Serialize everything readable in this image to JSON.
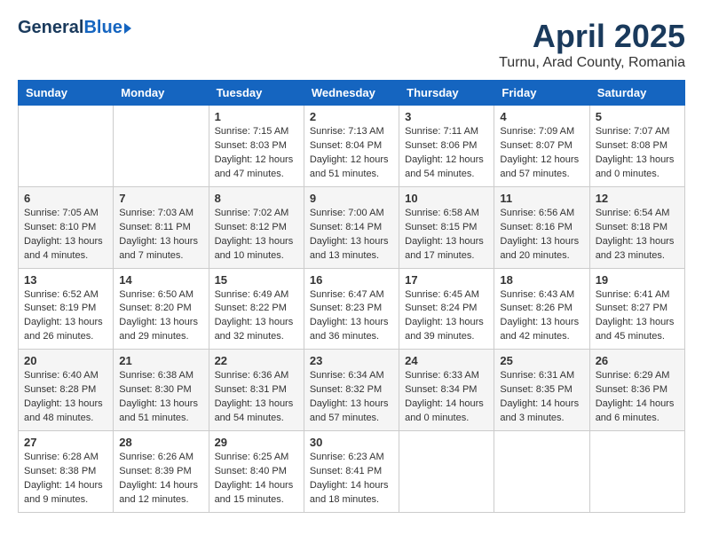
{
  "header": {
    "logo_general": "General",
    "logo_blue": "Blue",
    "month_year": "April 2025",
    "subtitle": "Turnu, Arad County, Romania"
  },
  "weekdays": [
    "Sunday",
    "Monday",
    "Tuesday",
    "Wednesday",
    "Thursday",
    "Friday",
    "Saturday"
  ],
  "weeks": [
    [
      {
        "day": "",
        "info": ""
      },
      {
        "day": "",
        "info": ""
      },
      {
        "day": "1",
        "info": "Sunrise: 7:15 AM\nSunset: 8:03 PM\nDaylight: 12 hours and 47 minutes."
      },
      {
        "day": "2",
        "info": "Sunrise: 7:13 AM\nSunset: 8:04 PM\nDaylight: 12 hours and 51 minutes."
      },
      {
        "day": "3",
        "info": "Sunrise: 7:11 AM\nSunset: 8:06 PM\nDaylight: 12 hours and 54 minutes."
      },
      {
        "day": "4",
        "info": "Sunrise: 7:09 AM\nSunset: 8:07 PM\nDaylight: 12 hours and 57 minutes."
      },
      {
        "day": "5",
        "info": "Sunrise: 7:07 AM\nSunset: 8:08 PM\nDaylight: 13 hours and 0 minutes."
      }
    ],
    [
      {
        "day": "6",
        "info": "Sunrise: 7:05 AM\nSunset: 8:10 PM\nDaylight: 13 hours and 4 minutes."
      },
      {
        "day": "7",
        "info": "Sunrise: 7:03 AM\nSunset: 8:11 PM\nDaylight: 13 hours and 7 minutes."
      },
      {
        "day": "8",
        "info": "Sunrise: 7:02 AM\nSunset: 8:12 PM\nDaylight: 13 hours and 10 minutes."
      },
      {
        "day": "9",
        "info": "Sunrise: 7:00 AM\nSunset: 8:14 PM\nDaylight: 13 hours and 13 minutes."
      },
      {
        "day": "10",
        "info": "Sunrise: 6:58 AM\nSunset: 8:15 PM\nDaylight: 13 hours and 17 minutes."
      },
      {
        "day": "11",
        "info": "Sunrise: 6:56 AM\nSunset: 8:16 PM\nDaylight: 13 hours and 20 minutes."
      },
      {
        "day": "12",
        "info": "Sunrise: 6:54 AM\nSunset: 8:18 PM\nDaylight: 13 hours and 23 minutes."
      }
    ],
    [
      {
        "day": "13",
        "info": "Sunrise: 6:52 AM\nSunset: 8:19 PM\nDaylight: 13 hours and 26 minutes."
      },
      {
        "day": "14",
        "info": "Sunrise: 6:50 AM\nSunset: 8:20 PM\nDaylight: 13 hours and 29 minutes."
      },
      {
        "day": "15",
        "info": "Sunrise: 6:49 AM\nSunset: 8:22 PM\nDaylight: 13 hours and 32 minutes."
      },
      {
        "day": "16",
        "info": "Sunrise: 6:47 AM\nSunset: 8:23 PM\nDaylight: 13 hours and 36 minutes."
      },
      {
        "day": "17",
        "info": "Sunrise: 6:45 AM\nSunset: 8:24 PM\nDaylight: 13 hours and 39 minutes."
      },
      {
        "day": "18",
        "info": "Sunrise: 6:43 AM\nSunset: 8:26 PM\nDaylight: 13 hours and 42 minutes."
      },
      {
        "day": "19",
        "info": "Sunrise: 6:41 AM\nSunset: 8:27 PM\nDaylight: 13 hours and 45 minutes."
      }
    ],
    [
      {
        "day": "20",
        "info": "Sunrise: 6:40 AM\nSunset: 8:28 PM\nDaylight: 13 hours and 48 minutes."
      },
      {
        "day": "21",
        "info": "Sunrise: 6:38 AM\nSunset: 8:30 PM\nDaylight: 13 hours and 51 minutes."
      },
      {
        "day": "22",
        "info": "Sunrise: 6:36 AM\nSunset: 8:31 PM\nDaylight: 13 hours and 54 minutes."
      },
      {
        "day": "23",
        "info": "Sunrise: 6:34 AM\nSunset: 8:32 PM\nDaylight: 13 hours and 57 minutes."
      },
      {
        "day": "24",
        "info": "Sunrise: 6:33 AM\nSunset: 8:34 PM\nDaylight: 14 hours and 0 minutes."
      },
      {
        "day": "25",
        "info": "Sunrise: 6:31 AM\nSunset: 8:35 PM\nDaylight: 14 hours and 3 minutes."
      },
      {
        "day": "26",
        "info": "Sunrise: 6:29 AM\nSunset: 8:36 PM\nDaylight: 14 hours and 6 minutes."
      }
    ],
    [
      {
        "day": "27",
        "info": "Sunrise: 6:28 AM\nSunset: 8:38 PM\nDaylight: 14 hours and 9 minutes."
      },
      {
        "day": "28",
        "info": "Sunrise: 6:26 AM\nSunset: 8:39 PM\nDaylight: 14 hours and 12 minutes."
      },
      {
        "day": "29",
        "info": "Sunrise: 6:25 AM\nSunset: 8:40 PM\nDaylight: 14 hours and 15 minutes."
      },
      {
        "day": "30",
        "info": "Sunrise: 6:23 AM\nSunset: 8:41 PM\nDaylight: 14 hours and 18 minutes."
      },
      {
        "day": "",
        "info": ""
      },
      {
        "day": "",
        "info": ""
      },
      {
        "day": "",
        "info": ""
      }
    ]
  ]
}
